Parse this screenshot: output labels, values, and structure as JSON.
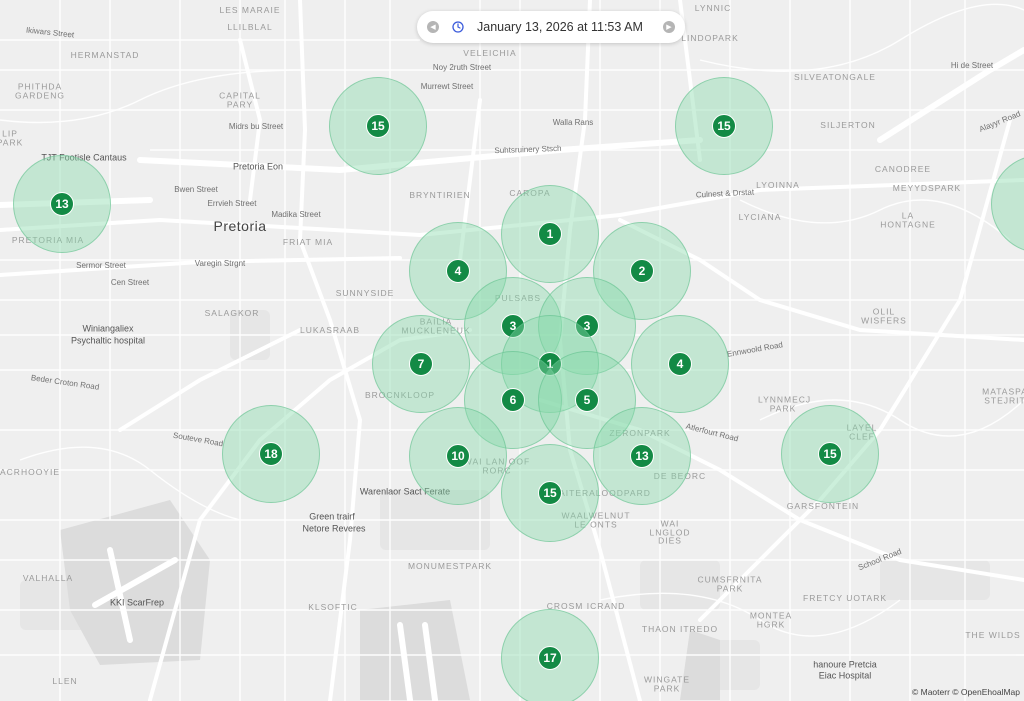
{
  "time_control": {
    "timestamp": "January 13, 2026 at 11:53 AM",
    "prev_icon": "chevron-left-icon",
    "next_icon": "chevron-right-icon",
    "clock_icon": "clock-icon"
  },
  "attribution": {
    "prefix": "©",
    "provider": "Maoterr",
    "separator": "©",
    "data": "OpenEhoalMap"
  },
  "colors": {
    "background": "#efefef",
    "cluster_fill": "#86d8aa",
    "cluster_marker": "#138a45",
    "road_major": "#ffffff"
  },
  "clusters": [
    {
      "count": "15"
    },
    {
      "count": "15"
    },
    {
      "count": "13"
    },
    {
      "count": "1"
    },
    {
      "count": "4"
    },
    {
      "count": "2"
    },
    {
      "count": "3"
    },
    {
      "count": "3"
    },
    {
      "count": "7"
    },
    {
      "count": "1"
    },
    {
      "count": "4"
    },
    {
      "count": "6"
    },
    {
      "count": "5"
    },
    {
      "count": "18"
    },
    {
      "count": "10"
    },
    {
      "count": "13"
    },
    {
      "count": "15"
    },
    {
      "count": "15"
    },
    {
      "count": "17"
    },
    {
      "count": ""
    }
  ],
  "labels": {
    "city": "Pretoria",
    "les_maraie": "LES MARAIE",
    "llilblal": "LLILBLAL",
    "hermanstad": "HERMANSTAD",
    "phithda_gardeng": "PHITHDA GARDENG",
    "lip_park": "LIP PARK",
    "capital_pary": "CAPITAL PARY",
    "veleichia": "VELEICHIA",
    "lynnic": "LYNNIC",
    "lindopark": "LINDOPARK",
    "silveatongale": "SILVEATONGALE",
    "siljerton": "SILJERTON",
    "canodree": "CANODREE",
    "meyydspark": "MEYYDSPARK",
    "lyoinna": "LYOINNA",
    "lyciana": "LYCIANA",
    "la_hontagne": "LA HONTAGNE",
    "bryntirien": "BRYNTIRIEN",
    "carora": "CAROPA",
    "friat_mia": "FRIAT MIA",
    "sunnyside": "SUNNYSIDE",
    "salagkor": "SALAGKOR",
    "lukasraab": "LUKASRAAB",
    "bailia_muckleneuk": "BAILIA MUCKLENEUK",
    "pulsabs": "PULSABS",
    "olil_wisfers": "OLIL WISFERS",
    "matasparts": "MATASPA STEJRIT",
    "brocnkloop": "BROCNKLOOP",
    "lynnmeg_park": "LYNNMECJ PARK",
    "layel_clef": "LAYEL CLEF",
    "acrhooyie": "ACRHOOYIE",
    "zeronpark": "ZERONPARK",
    "de_beorc": "DE BEORC",
    "wai_lan_oof_rorc": "WAI LAN OOF RORC",
    "garsfontein": "GARSFONTEIN",
    "aiteralodpard": "AITERALOODPARD",
    "waalwelnut_le_onts": "WAALWELNUT LE ONTS",
    "wai_lnglod_dies": "WAI LNGLOD DIES",
    "monumestpark": "MONUMESTPARK",
    "valhalla": "VALHALLA",
    "cumsfrnita_park": "CUMSFRNITA PARK",
    "fretcy_uotark": "FRETCY UOTARK",
    "klsoftic": "KLSOFTIC",
    "crosm_icrand": "CROSM ICRAND",
    "thaon_itredo": "THAON ITREDO",
    "the_wilds": "THE WILDS",
    "montea_hgrk": "MONTEA HGRK",
    "wingate_park": "WINGATE PARK",
    "llen": "LLEN",
    "ikiwars_street": "Ikiwars Street",
    "pretoria_mia": "PRETORIA MIA",
    "tjt_footisle": "TJT Footisle Cantaus",
    "pretoria_eon": "Pretoria Eon",
    "bwen_street": "Bwen Street",
    "errvieh_street": "Errvieh Street",
    "madika_street": "Madika Street",
    "sermor_street": "Sermor Street",
    "varegin_strgnt": "Varegin Strgnt",
    "cen_street": "Cen Street",
    "winiangaliex": "Winiangaliex",
    "psychaltic_hospital": "Psychaltic hospital",
    "beder_croton_road": "Beder Croton Road",
    "souteve_road": "Souteve Road",
    "noy_2ruth_street": "Noy 2ruth Street",
    "murrewt_street": "Murrewt Street",
    "walla_rans": "Walla Rans",
    "suhtsruinery_stsch": "Suhtsruinery Stsch",
    "mubs_bu_street": "Midrs bu Street",
    "culnest_drstat": "Culnest & Drstat",
    "warenlaor_sact_ferate": "Warenlaor Sact Ferate",
    "green_trairf": "Green trairf",
    "netore_reveres": "Netore Reveres",
    "kki_scar_frep": "KKI ScarFrep",
    "hanoure_pretcia": "hanoure Pretcia",
    "eiac_hospital": "Eiac Hospital",
    "school_road": "School Road",
    "atlerfourt_road": "Atlerfourt Road",
    "ennwoold_road": "Ennwoold Road",
    "hi_de_street": "Hi de Street",
    "alayyr_road": "Alayyr Road"
  }
}
